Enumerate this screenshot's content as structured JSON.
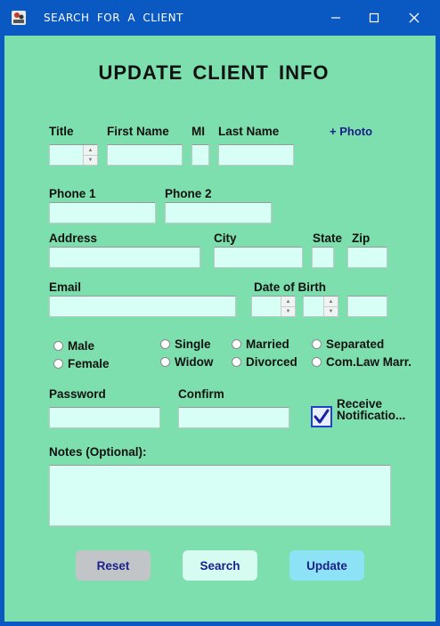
{
  "window": {
    "title": "SEARCH FOR A CLIENT"
  },
  "form": {
    "heading": "UPDATE CLIENT INFO",
    "labels": {
      "title": "Title",
      "first_name": "First Name",
      "mi": "MI",
      "last_name": "Last Name",
      "phone1": "Phone 1",
      "phone2": "Phone 2",
      "address": "Address",
      "city": "City",
      "state": "State",
      "zip": "Zip",
      "email": "Email",
      "dob": "Date of Birth",
      "password": "Password",
      "confirm": "Confirm",
      "notes": "Notes (Optional):"
    },
    "photo_link": "+ Photo",
    "gender": [
      "Male",
      "Female"
    ],
    "marital": [
      "Single",
      "Married",
      "Separated",
      "Widow",
      "Divorced",
      "Com.Law Marr."
    ],
    "notify": {
      "line1": "Receive",
      "line2": "Notificatio...",
      "checked": true
    },
    "buttons": {
      "reset": "Reset",
      "search": "Search",
      "update": "Update"
    }
  },
  "colors": {
    "titlebar": "#0a58c2",
    "background": "#7ddfae",
    "field": "#d7fff5",
    "reset_button": "#c2c5c7",
    "search_button": "#d6fbf0",
    "update_button": "#8ee2f6"
  },
  "icons": {
    "app": "app-icon",
    "minimize": "minimize-icon",
    "maximize": "maximize-icon",
    "close": "close-icon",
    "checkmark": "checkmark-icon"
  }
}
